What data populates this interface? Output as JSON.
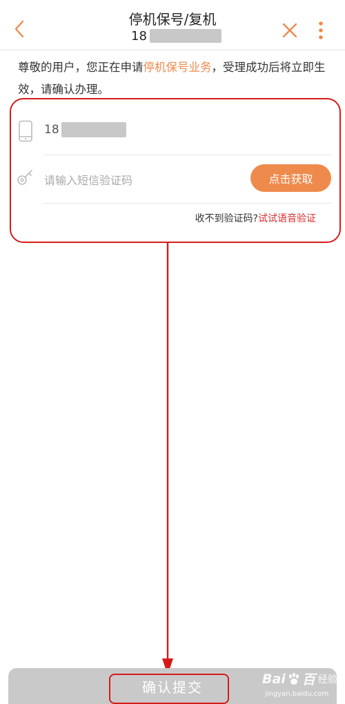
{
  "header": {
    "title": "停机保号/复机",
    "phone_prefix": "18",
    "back_icon": "chevron-left-icon",
    "close_icon": "close-icon",
    "more_icon": "more-vertical-icon"
  },
  "notice": {
    "text_before": "尊敬的用户，您正在申请",
    "highlight": "停机保号业务",
    "text_after": "，受理成功后将立即生效，请确认办理。"
  },
  "form": {
    "phone_prefix": "18",
    "phone_icon": "phone-icon",
    "key_icon": "key-icon",
    "code_placeholder": "请输入短信验证码",
    "code_value": "",
    "get_code_label": "点击获取",
    "voice_prompt": "收不到验证码?",
    "voice_link": "试试语音验证"
  },
  "submit": {
    "label": "确认提交"
  },
  "watermark": {
    "brand_left": "Bai",
    "brand_right": "百",
    "brand_cn": "经验",
    "url": "jingyan.baidu.com"
  },
  "colors": {
    "accent": "#ef8a4d",
    "link_red": "#d72d2d",
    "annotation_red": "#d61a1a",
    "submit_disabled": "#c9c9c9"
  }
}
